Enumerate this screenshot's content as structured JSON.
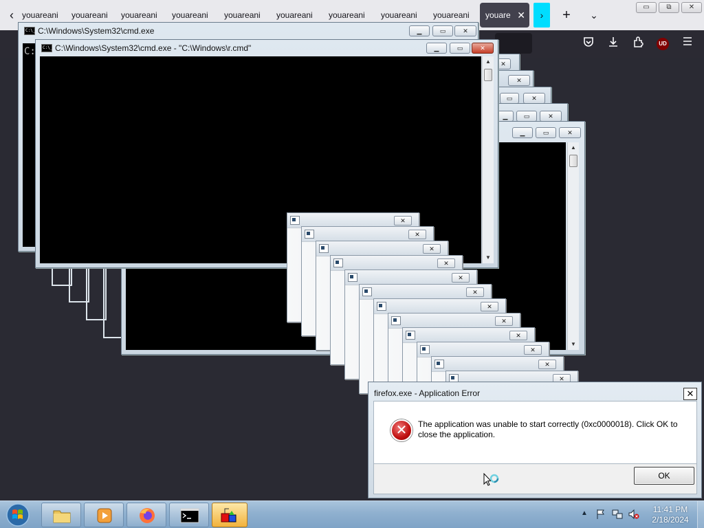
{
  "browser": {
    "bg_tab_label": "youareani",
    "active_tab_label": "youare",
    "tab_close": "✕",
    "back": "‹",
    "scroll_tabs": "›",
    "new_tab": "+",
    "tab_list": "⌄",
    "win_min": "▭",
    "win_restore": "⧉",
    "win_close": "✕",
    "toolbar_icons": [
      "pocket-icon",
      "download-icon",
      "extensions-icon",
      "ublock-icon",
      "menu-icon"
    ],
    "ublock_label": "UD"
  },
  "cmd_main": {
    "title": "C:\\Windows\\System32\\cmd.exe",
    "console_text": "C:"
  },
  "cmd_front": {
    "title": "C:\\Windows\\System32\\cmd.exe - \"C:\\Windows\\r.cmd\""
  },
  "window_buttons": {
    "minimize": "▁",
    "maximize": "▭",
    "close": "✕"
  },
  "scroll": {
    "up": "▲",
    "down": "▼"
  },
  "cmd_icon_text": "C:\\_",
  "error_dialog": {
    "title": "firefox.exe - Application Error",
    "close": "✕",
    "icon": "✕",
    "message": "The application was unable to start correctly (0xc0000018). Click OK to close the application.",
    "ok": "OK"
  },
  "taskbar": {
    "apps": [
      "explorer",
      "media-player",
      "firefox",
      "cmd",
      "paint"
    ],
    "active_app": "cmd",
    "tray_arrow": "▲",
    "time": "11:41 PM",
    "date": "2/18/2024"
  },
  "colors": {
    "taskbar": "#8fb0cf",
    "console": "#000000",
    "error_red": "#c01010",
    "tab_accent": "#00ddff"
  }
}
